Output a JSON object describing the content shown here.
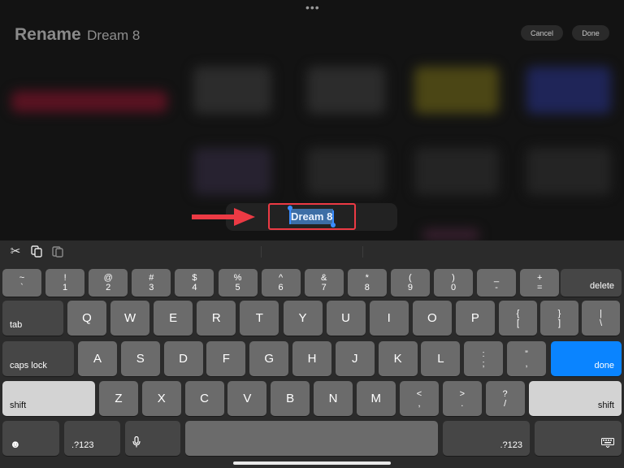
{
  "header": {
    "title": "Rename",
    "subtitle": "Dream 8",
    "more_icon": "ellipsis-icon",
    "cancel_label": "Cancel",
    "done_label": "Done"
  },
  "rename": {
    "value": "Dream 8"
  },
  "shortcut_bar": [
    "scissors-icon",
    "copy-icon",
    "paste-icon"
  ],
  "keyboard": {
    "row1": [
      {
        "top": "~",
        "bottom": "`"
      },
      {
        "top": "!",
        "bottom": "1"
      },
      {
        "top": "@",
        "bottom": "2"
      },
      {
        "top": "#",
        "bottom": "3"
      },
      {
        "top": "$",
        "bottom": "4"
      },
      {
        "top": "%",
        "bottom": "5"
      },
      {
        "top": "^",
        "bottom": "6"
      },
      {
        "top": "&",
        "bottom": "7"
      },
      {
        "top": "*",
        "bottom": "8"
      },
      {
        "top": "(",
        "bottom": "9"
      },
      {
        "top": ")",
        "bottom": "0"
      },
      {
        "top": "_",
        "bottom": "-"
      },
      {
        "top": "+",
        "bottom": "="
      }
    ],
    "delete": "delete",
    "tab": "tab",
    "row2": [
      "Q",
      "W",
      "E",
      "R",
      "T",
      "Y",
      "U",
      "I",
      "O",
      "P"
    ],
    "row2_sym": [
      {
        "top": "{",
        "bottom": "["
      },
      {
        "top": "}",
        "bottom": "]"
      },
      {
        "top": "|",
        "bottom": "\\"
      }
    ],
    "caps_lock": "caps lock",
    "row3": [
      "A",
      "S",
      "D",
      "F",
      "G",
      "H",
      "J",
      "K",
      "L"
    ],
    "row3_sym": [
      {
        "top": ":",
        "bottom": ";"
      },
      {
        "top": "”",
        "bottom": ","
      }
    ],
    "done": "done",
    "shift": "shift",
    "row4": [
      "Z",
      "X",
      "C",
      "V",
      "B",
      "N",
      "M"
    ],
    "row4_sym": [
      {
        "top": "<",
        "bottom": ","
      },
      {
        "top": ">",
        "bottom": "."
      },
      {
        "top": "?",
        "bottom": "/"
      }
    ],
    "numbers": ".?123",
    "emoji_icon": "emoji-icon",
    "mic_icon": "microphone-icon",
    "hide_keyboard_icon": "keyboard-hide-icon"
  },
  "colors": {
    "accent": "#0a84ff",
    "highlight_box": "#ec3a44",
    "arrow": "#ec3a44"
  }
}
